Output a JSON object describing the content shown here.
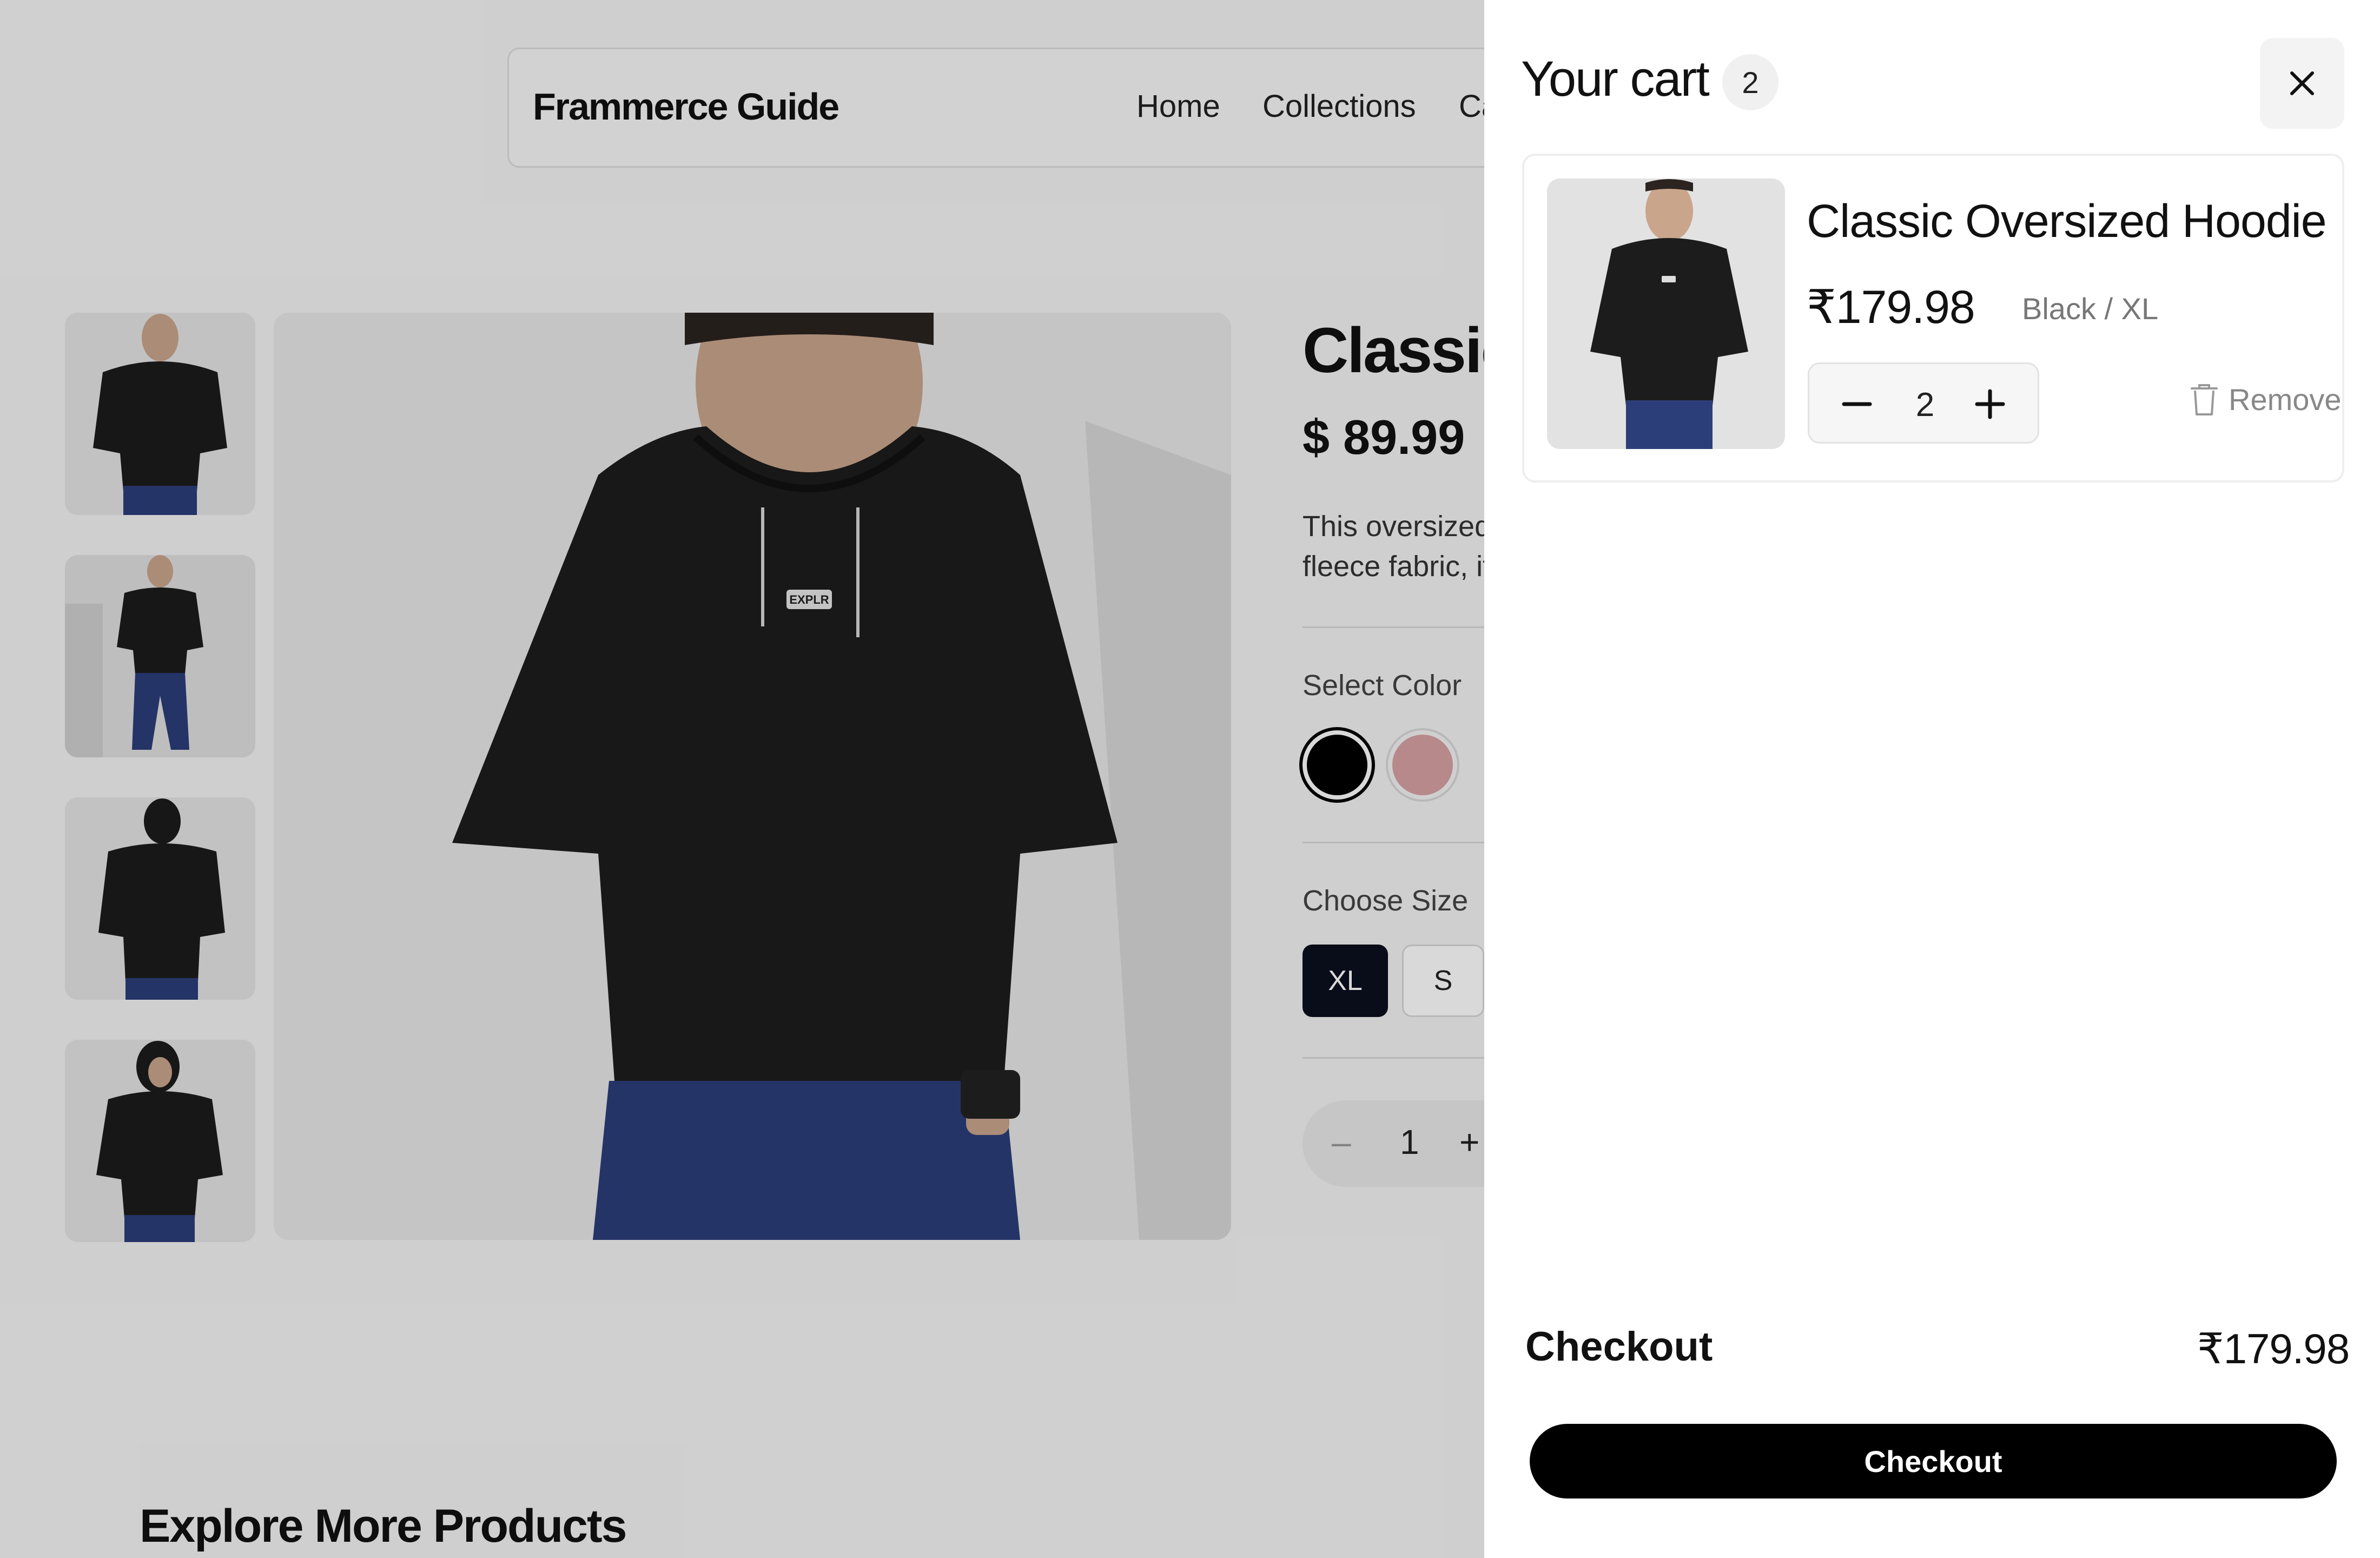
{
  "nav": {
    "brand": "Frammerce Guide",
    "links": [
      "Home",
      "Collections",
      "Ca"
    ]
  },
  "product": {
    "title": "Classic",
    "price": "$ 89.99",
    "description_line1": "This oversized",
    "description_line2": "fleece fabric, it",
    "select_color_label": "Select Color",
    "colors": [
      "#000000",
      "#d7a1a4"
    ],
    "choose_size_label": "Choose Size",
    "sizes": [
      "XL",
      "S"
    ],
    "selected_size": "XL",
    "quantity": "1"
  },
  "explore": {
    "title": "Explore More Products"
  },
  "cart": {
    "title": "Your cart",
    "count": "2",
    "item": {
      "name": "Classic Oversized Hoodie",
      "price": "₹179.98",
      "variant": "Black / XL",
      "quantity": "2",
      "remove_label": "Remove"
    },
    "checkout_label": "Checkout",
    "total": "₹179.98",
    "checkout_button": "Checkout"
  },
  "icons": {
    "close": "close-icon",
    "minus": "minus-icon",
    "plus": "plus-icon",
    "trash": "trash-icon"
  }
}
